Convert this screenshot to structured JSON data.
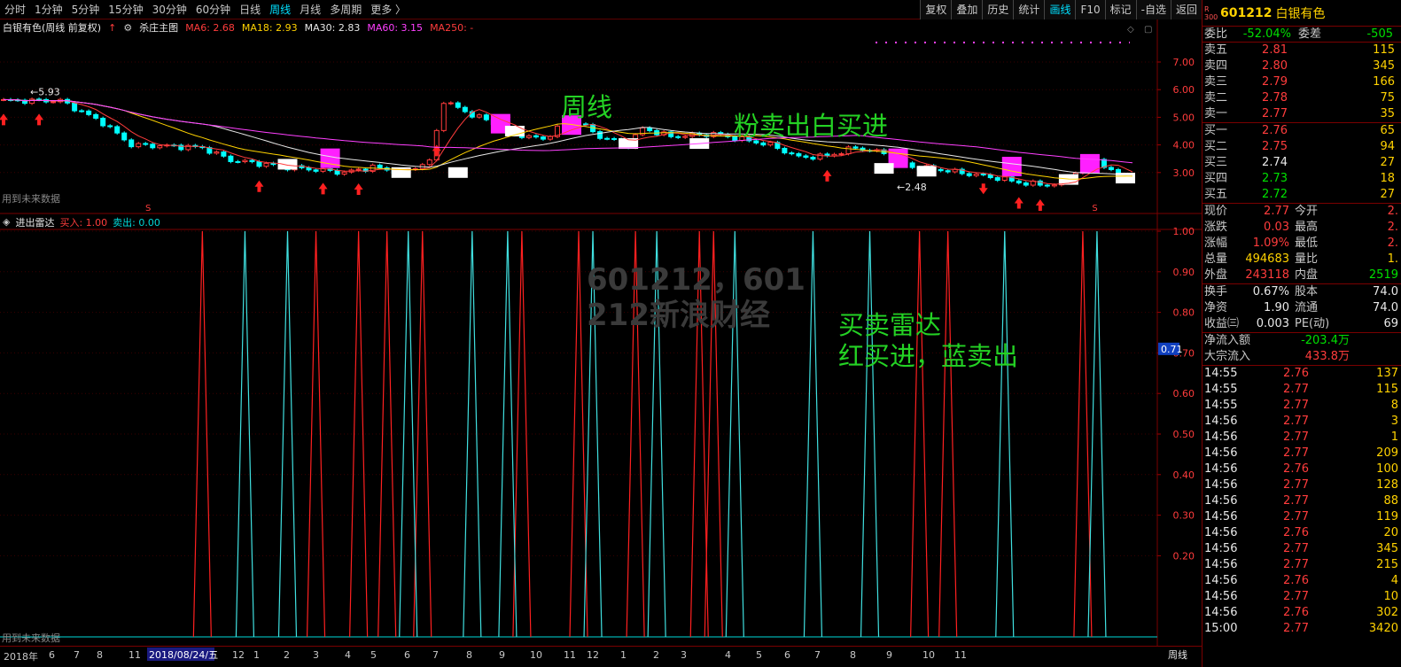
{
  "period_tabs": [
    {
      "label": "分时",
      "active": false
    },
    {
      "label": "1分钟",
      "active": false
    },
    {
      "label": "5分钟",
      "active": false
    },
    {
      "label": "15分钟",
      "active": false
    },
    {
      "label": "30分钟",
      "active": false
    },
    {
      "label": "60分钟",
      "active": false
    },
    {
      "label": "日线",
      "active": false
    },
    {
      "label": "周线",
      "active": true
    },
    {
      "label": "月线",
      "active": false
    },
    {
      "label": "多周期",
      "active": false
    },
    {
      "label": "更多 〉",
      "active": false
    }
  ],
  "toolbar": [
    "复权",
    "叠加",
    "历史",
    "统计",
    "画线",
    "F10",
    "标记",
    "-自选",
    "返回"
  ],
  "toolbar_active": "画线",
  "main_chart": {
    "title": "白银有色(周线 前复权)",
    "formula": "杀庄主图",
    "ma_labels": [
      {
        "text": "MA6: 2.68",
        "color": "#ff3c3c"
      },
      {
        "text": "MA18: 2.93",
        "color": "#ffd200"
      },
      {
        "text": "MA30: 2.83",
        "color": "#e8e8e8"
      },
      {
        "text": "MA60: 3.15",
        "color": "#ff40ff"
      },
      {
        "text": "MA250: -",
        "color": "#ff3c3c"
      }
    ],
    "y_ticks": [
      "7.00",
      "6.00",
      "5.00",
      "4.00",
      "3.00"
    ],
    "high_label": "5.93",
    "low_label": "2.48",
    "future_data_note": "用到未来数据"
  },
  "indicator": {
    "title": "进出雷达",
    "buy_label": "买入: 1.00",
    "sell_label": "卖出: 0.00",
    "y_ticks": [
      "1.00",
      "0.90",
      "0.80",
      "0.70",
      "0.60",
      "0.50",
      "0.40",
      "0.30",
      "0.20"
    ],
    "current_value": "0.71",
    "future_data_note": "用到未来数据",
    "red_pulses": [
      28,
      44,
      50,
      54,
      59,
      73,
      81,
      89,
      98,
      100,
      129,
      133,
      152
    ],
    "cyan_pulses": [
      34,
      40,
      57,
      66,
      71,
      83,
      92,
      103,
      114,
      122,
      141,
      154
    ]
  },
  "annotations": {
    "weekly": "周线",
    "pink_white": "粉卖出白买进",
    "radar_line1": "买卖雷达",
    "radar_line2": "红买进，蓝卖出",
    "watermark_line1": "601212，601",
    "watermark_line2": "212新浪财经"
  },
  "bottom_axis": {
    "year": "2018年",
    "selected_date": "2018/08/24/五",
    "months": [
      "6",
      "7",
      "8",
      "11",
      "12",
      "1",
      "2",
      "3",
      "4",
      "5",
      "6",
      "7",
      "8",
      "9",
      "10",
      "11",
      "12",
      "1",
      "2",
      "3",
      "4",
      "5",
      "6",
      "7",
      "8",
      "9",
      "10",
      "11"
    ],
    "period": "周线"
  },
  "stock": {
    "badge_top": "R",
    "badge_bottom": "300",
    "code": "601212",
    "name": "白银有色",
    "weibi_label": "委比",
    "weibi_value": "-52.04%",
    "weicha_label": "委差",
    "weicha_value": "-505",
    "asks": [
      {
        "label": "卖五",
        "price": "2.81",
        "volume": "115"
      },
      {
        "label": "卖四",
        "price": "2.80",
        "volume": "345"
      },
      {
        "label": "卖三",
        "price": "2.79",
        "volume": "166"
      },
      {
        "label": "卖二",
        "price": "2.78",
        "volume": "75"
      },
      {
        "label": "卖一",
        "price": "2.77",
        "volume": "35"
      }
    ],
    "bids": [
      {
        "label": "买一",
        "price": "2.76",
        "volume": "65",
        "color": "red"
      },
      {
        "label": "买二",
        "price": "2.75",
        "volume": "94",
        "color": "red"
      },
      {
        "label": "买三",
        "price": "2.74",
        "volume": "27",
        "color": "white"
      },
      {
        "label": "买四",
        "price": "2.73",
        "volume": "18",
        "color": "green"
      },
      {
        "label": "买五",
        "price": "2.72",
        "volume": "27",
        "color": "green"
      }
    ],
    "quote": [
      {
        "l1": "现价",
        "v1": "2.77",
        "c1": "red",
        "l2": "今开",
        "v2": "2.",
        "c2": "red"
      },
      {
        "l1": "涨跌",
        "v1": "0.03",
        "c1": "red",
        "l2": "最高",
        "v2": "2.",
        "c2": "red"
      },
      {
        "l1": "涨幅",
        "v1": "1.09%",
        "c1": "red",
        "l2": "最低",
        "v2": "2.",
        "c2": "red"
      },
      {
        "l1": "总量",
        "v1": "494683",
        "c1": "yellow",
        "l2": "量比",
        "v2": "1.",
        "c2": "yellow"
      },
      {
        "l1": "外盘",
        "v1": "243118",
        "c1": "red",
        "l2": "内盘",
        "v2": "2519",
        "c2": "green"
      }
    ],
    "finance": [
      {
        "l1": "换手",
        "v1": "0.67%",
        "l2": "股本",
        "v2": "74.0"
      },
      {
        "l1": "净资",
        "v1": "1.90",
        "l2": "流通",
        "v2": "74.0"
      },
      {
        "l1": "收益㈢",
        "v1": "0.003",
        "l2": "PE(动)",
        "v2": "69"
      }
    ],
    "flows": [
      {
        "label": "净流入额",
        "value": "-203.4万",
        "color": "green"
      },
      {
        "label": "大宗流入",
        "value": "433.8万",
        "color": "red"
      }
    ],
    "ticks": [
      {
        "time": "14:55",
        "price": "2.76",
        "pc": "red",
        "vol": "137"
      },
      {
        "time": "14:55",
        "price": "2.77",
        "pc": "red",
        "vol": "115"
      },
      {
        "time": "14:55",
        "price": "2.77",
        "pc": "red",
        "vol": "8"
      },
      {
        "time": "14:56",
        "price": "2.77",
        "pc": "red",
        "vol": "3"
      },
      {
        "time": "14:56",
        "price": "2.77",
        "pc": "red",
        "vol": "1"
      },
      {
        "time": "14:56",
        "price": "2.77",
        "pc": "red",
        "vol": "209"
      },
      {
        "time": "14:56",
        "price": "2.76",
        "pc": "red",
        "vol": "100"
      },
      {
        "time": "14:56",
        "price": "2.77",
        "pc": "red",
        "vol": "128"
      },
      {
        "time": "14:56",
        "price": "2.77",
        "pc": "red",
        "vol": "88"
      },
      {
        "time": "14:56",
        "price": "2.77",
        "pc": "red",
        "vol": "119"
      },
      {
        "time": "14:56",
        "price": "2.76",
        "pc": "red",
        "vol": "20"
      },
      {
        "time": "14:56",
        "price": "2.77",
        "pc": "red",
        "vol": "345"
      },
      {
        "time": "14:56",
        "price": "2.77",
        "pc": "red",
        "vol": "215"
      },
      {
        "time": "14:56",
        "price": "2.76",
        "pc": "red",
        "vol": "4"
      },
      {
        "time": "14:56",
        "price": "2.77",
        "pc": "red",
        "vol": "10"
      },
      {
        "time": "14:56",
        "price": "2.76",
        "pc": "red",
        "vol": "302"
      },
      {
        "time": "15:00",
        "price": "2.77",
        "pc": "red",
        "vol": "3420"
      }
    ]
  }
}
